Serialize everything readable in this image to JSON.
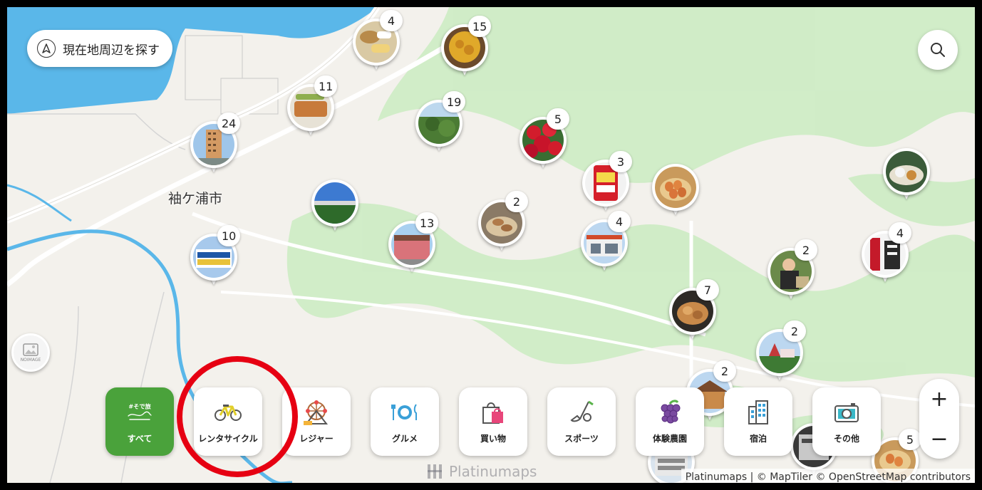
{
  "search_bar": {
    "location_label": "現在地周辺を探す"
  },
  "map": {
    "city_label": "袖ケ浦市",
    "noimage_label": "NOIMAGE",
    "water_color": "#5ab7e9",
    "land_color": "#f3f1ec",
    "green_color": "#cfecc6",
    "markers": [
      {
        "count": "4"
      },
      {
        "count": "15"
      },
      {
        "count": "11"
      },
      {
        "count": "24"
      },
      {
        "count": "19"
      },
      {
        "count": "5"
      },
      {
        "count": "3"
      },
      {
        "count": ""
      },
      {
        "count": ""
      },
      {
        "count": "2"
      },
      {
        "count": ""
      },
      {
        "count": "10"
      },
      {
        "count": "13"
      },
      {
        "count": "4"
      },
      {
        "count": "4"
      },
      {
        "count": "2"
      },
      {
        "count": "7"
      },
      {
        "count": "2"
      },
      {
        "count": "2"
      },
      {
        "count": "5"
      },
      {
        "count": ""
      },
      {
        "count": ""
      }
    ]
  },
  "categories": {
    "all": {
      "label": "すべて",
      "logo_text": "#そで旅",
      "color": "#4aa23b"
    },
    "items": [
      {
        "label": "レンタサイクル",
        "icon": "bicycle-icon"
      },
      {
        "label": "レジャー",
        "icon": "ferris-wheel-icon"
      },
      {
        "label": "グルメ",
        "icon": "plate-cutlery-icon"
      },
      {
        "label": "買い物",
        "icon": "shopping-bag-icon"
      },
      {
        "label": "スポーツ",
        "icon": "golf-icon"
      },
      {
        "label": "体験農園",
        "icon": "grapes-icon"
      },
      {
        "label": "宿泊",
        "icon": "hotel-building-icon"
      },
      {
        "label": "その他",
        "icon": "camera-icon"
      }
    ]
  },
  "zoom": {
    "in_label": "+",
    "out_label": "−"
  },
  "annotation": {
    "highlight_color": "#e60012"
  },
  "footer": {
    "watermark": "Platinumaps",
    "attribution": "Platinumaps | © MapTiler © OpenStreetMap contributors"
  }
}
